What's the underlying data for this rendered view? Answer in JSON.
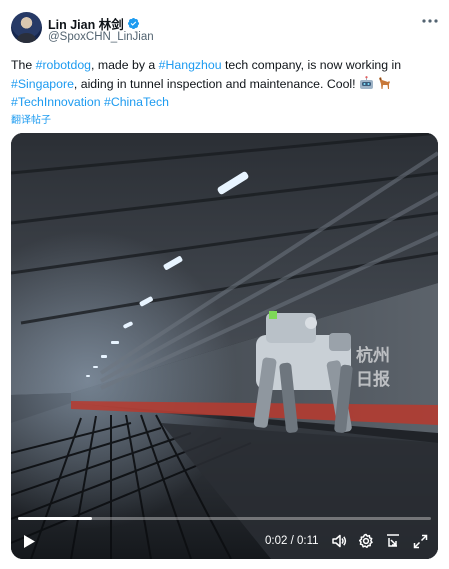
{
  "author": {
    "display_name": "Lin Jian 林剑",
    "handle": "@SpoxCHN_LinJian"
  },
  "tweet": {
    "t1": "The ",
    "tag_robotdog": "#robotdog",
    "t2": ", made by a ",
    "tag_hangzhou": "#Hangzhou",
    "t3": " tech company, is now working in ",
    "tag_singapore": "#Singapore",
    "t4": ", aiding in tunnel inspection and maintenance. Cool! ",
    "tag_techinnovation": "#TechInnovation",
    "tag_chinatech": "#ChinaTech",
    "translate_label": "翻译帖子"
  },
  "video": {
    "watermark_line1": "杭州",
    "watermark_line2": "日报",
    "time_current": "0:02",
    "time_total": "0:11",
    "progress": 0.18
  },
  "icons": {
    "verified": "verified-badge-icon",
    "more": "more-dots-icon",
    "play": "play-icon",
    "volume": "volume-icon",
    "settings": "settings-gear-icon",
    "pip": "picture-in-picture-icon",
    "fullscreen": "fullscreen-icon"
  },
  "colors": {
    "accent": "#1d9bf0",
    "text": "#0f1419",
    "muted": "#536471"
  }
}
